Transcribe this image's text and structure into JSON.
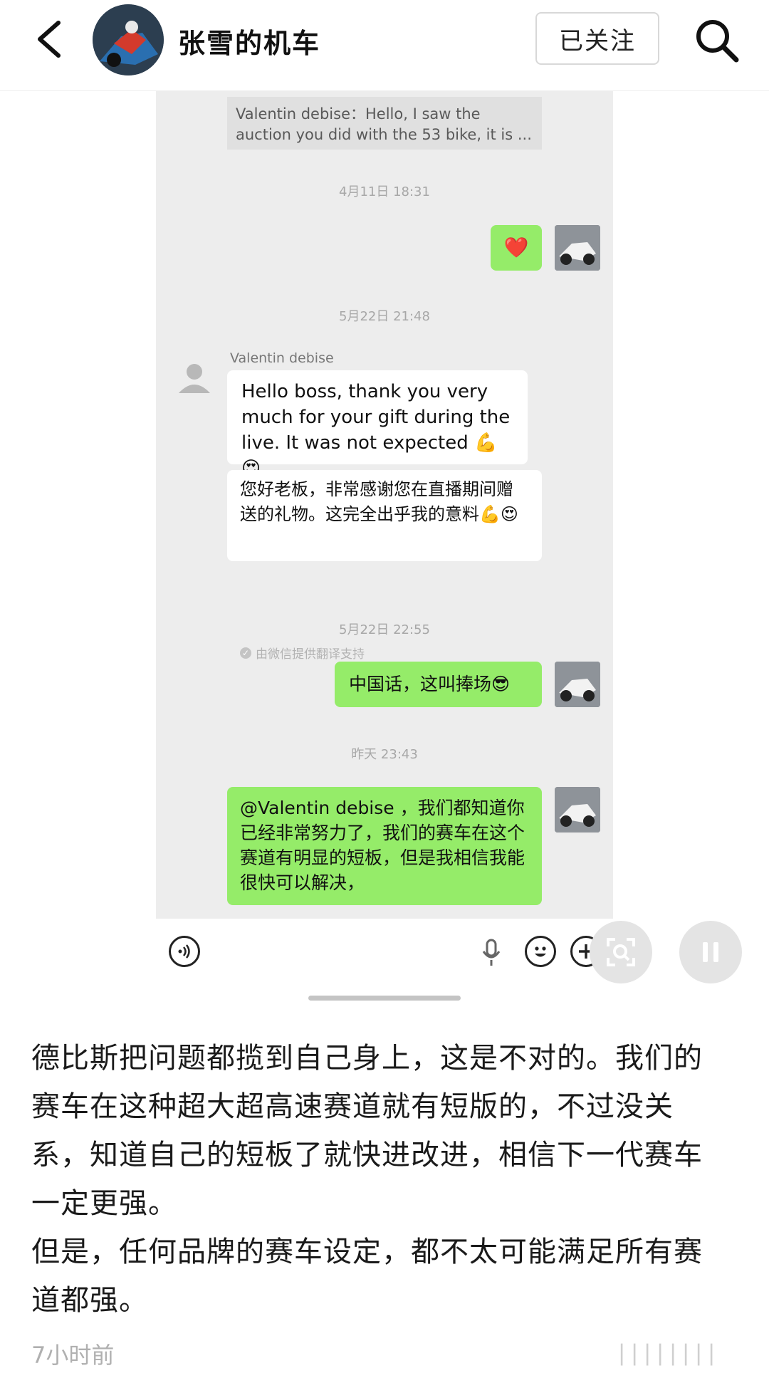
{
  "header": {
    "username": "张雪的机车",
    "follow_label": "已关注"
  },
  "chat": {
    "quote_text": "Valentin debise：Hello, I saw the auction you did with the 53 bike, it is ...",
    "time1": "4月11日 18:31",
    "heart_emoji": "❤️",
    "time2": "5月22日 21:48",
    "sender_name": "Valentin debise",
    "msg_en": "Hello boss, thank you very much for your gift during the live. It was not expected 💪😍",
    "msg_translated": "您好老板，非常感谢您在直播期间赠送的礼物。这完全出乎我的意料💪😍",
    "translate_note": "由微信提供翻译支持",
    "time3": "5月22日 22:55",
    "msg_short": "中国话，这叫捧场😎",
    "time4": "昨天 23:43",
    "msg_long": "@Valentin debise ，我们都知道你已经非常努力了，我们的赛车在这个赛道有明显的短板，但是我相信我能很快可以解决，"
  },
  "post": {
    "body": "德比斯把问题都揽到自己身上，这是不对的。我们的赛车在这种超大超高速赛道就有短版的，不过没关系，知道自己的短板了就快进改进，相信下一代赛车一定更强。\n但是，任何品牌的赛车设定，都不太可能满足所有赛道都强。",
    "time": "7小时前"
  },
  "colors": {
    "chat_bg": "#ededed",
    "green_bubble": "#95ec69",
    "white_bubble": "#ffffff"
  },
  "icons": [
    "back-arrow-icon",
    "search-icon",
    "voice-icon",
    "microphone-icon",
    "emoji-icon",
    "plus-icon",
    "scan-icon",
    "pause-icon"
  ]
}
